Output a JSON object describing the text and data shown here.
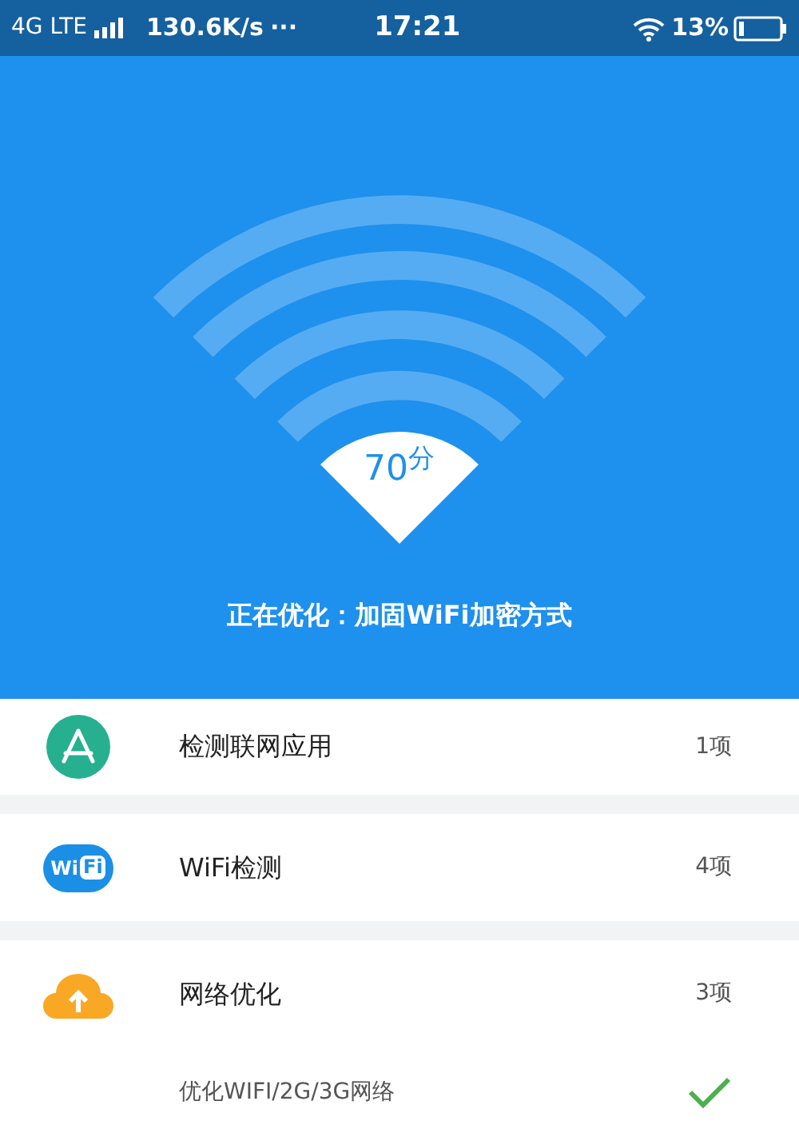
{
  "status_bar": {
    "network": "4G LTE",
    "speed": "130.6K/s",
    "more": "···",
    "time": "17:21",
    "battery": "13%"
  },
  "hero": {
    "score": "70$^{分}$",
    "message": "正在优化：加固WiFi加密方式"
  },
  "groups": [
    {
      "kind": "apps",
      "title": "检测联网应用",
      "count": "1项"
    },
    {
      "kind": "wifi",
      "title": "WiFi检测",
      "count": "4项",
      "badge": [
        "Wi",
        "Fi"
      ]
    },
    {
      "kind": "network",
      "title": "网络优化",
      "count": "3项",
      "subitems": [
        {
          "label": "优化WIFI/2G/3G网络",
          "done": true
        }
      ]
    }
  ]
}
